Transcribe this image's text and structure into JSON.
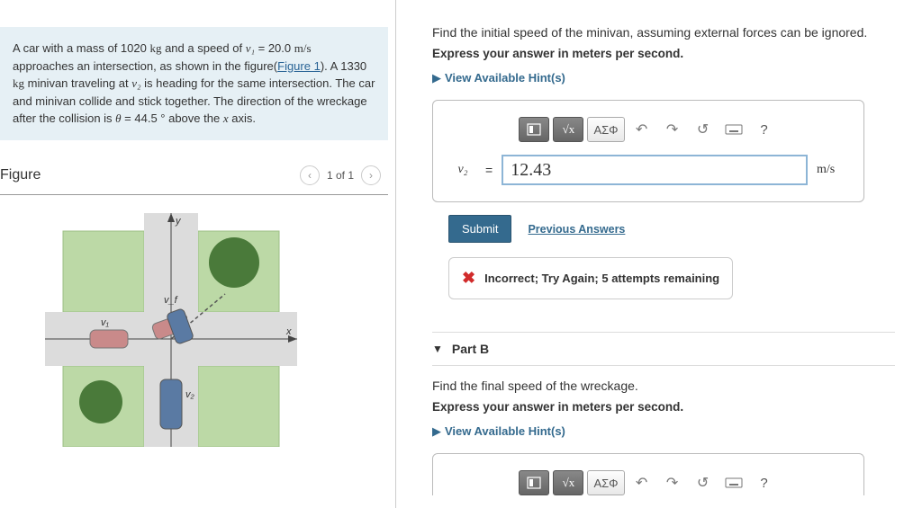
{
  "problem": {
    "text_before_link": "A car with a mass of 1020 ",
    "kg1": "kg",
    "text2": " and a speed of ",
    "v1sym": "v₁",
    "eq1": " = 20.0 ",
    "ms": "m/s",
    "text3": " approaches an intersection, as shown in the figure(",
    "link": "Figure 1",
    "text4": "). A 1330 ",
    "kg2": "kg",
    "text5": " minivan traveling at ",
    "v2sym": "v₂",
    "text6": " is heading for the same intersection. The car and minivan collide and stick together. The direction of the wreckage after the collision is ",
    "theta": "θ",
    "text7": " = 44.5 ° above the ",
    "xaxis": "x",
    "text8": " axis."
  },
  "figure": {
    "title": "Figure",
    "counter": "1 of 1"
  },
  "partA": {
    "question": "Find the initial speed of the minivan, assuming external forces can be ignored.",
    "instruction": "Express your answer in meters per second.",
    "hints": "View Available Hint(s)",
    "var": "v₂",
    "eq": "=",
    "value": "12.43",
    "unit": "m/s",
    "toolbar": {
      "greek": "ΑΣΦ",
      "help": "?"
    },
    "submit": "Submit",
    "prev": "Previous Answers",
    "feedback": "Incorrect; Try Again; 5 attempts remaining"
  },
  "partB": {
    "label": "Part B",
    "question": "Find the final speed of the wreckage.",
    "instruction": "Express your answer in meters per second.",
    "hints": "View Available Hint(s)",
    "toolbar": {
      "greek": "ΑΣΦ",
      "help": "?"
    }
  }
}
